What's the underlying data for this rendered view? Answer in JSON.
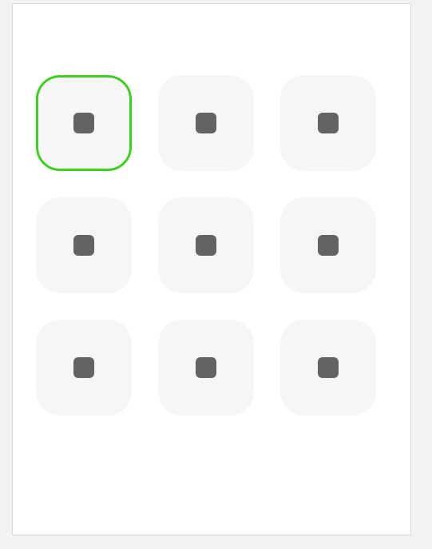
{
  "grid": {
    "rows": 3,
    "columns": 3,
    "selected_index": 0,
    "colors": {
      "panel_background": "#ffffff",
      "tile_background": "#f6f6f6",
      "selected_border": "#3ecf1f",
      "dot": "#636363"
    },
    "tiles": [
      {
        "row": 1,
        "col": 1,
        "selected": true
      },
      {
        "row": 1,
        "col": 2,
        "selected": false
      },
      {
        "row": 1,
        "col": 3,
        "selected": false
      },
      {
        "row": 2,
        "col": 1,
        "selected": false
      },
      {
        "row": 2,
        "col": 2,
        "selected": false
      },
      {
        "row": 2,
        "col": 3,
        "selected": false
      },
      {
        "row": 3,
        "col": 1,
        "selected": false
      },
      {
        "row": 3,
        "col": 2,
        "selected": false
      },
      {
        "row": 3,
        "col": 3,
        "selected": false
      }
    ]
  }
}
